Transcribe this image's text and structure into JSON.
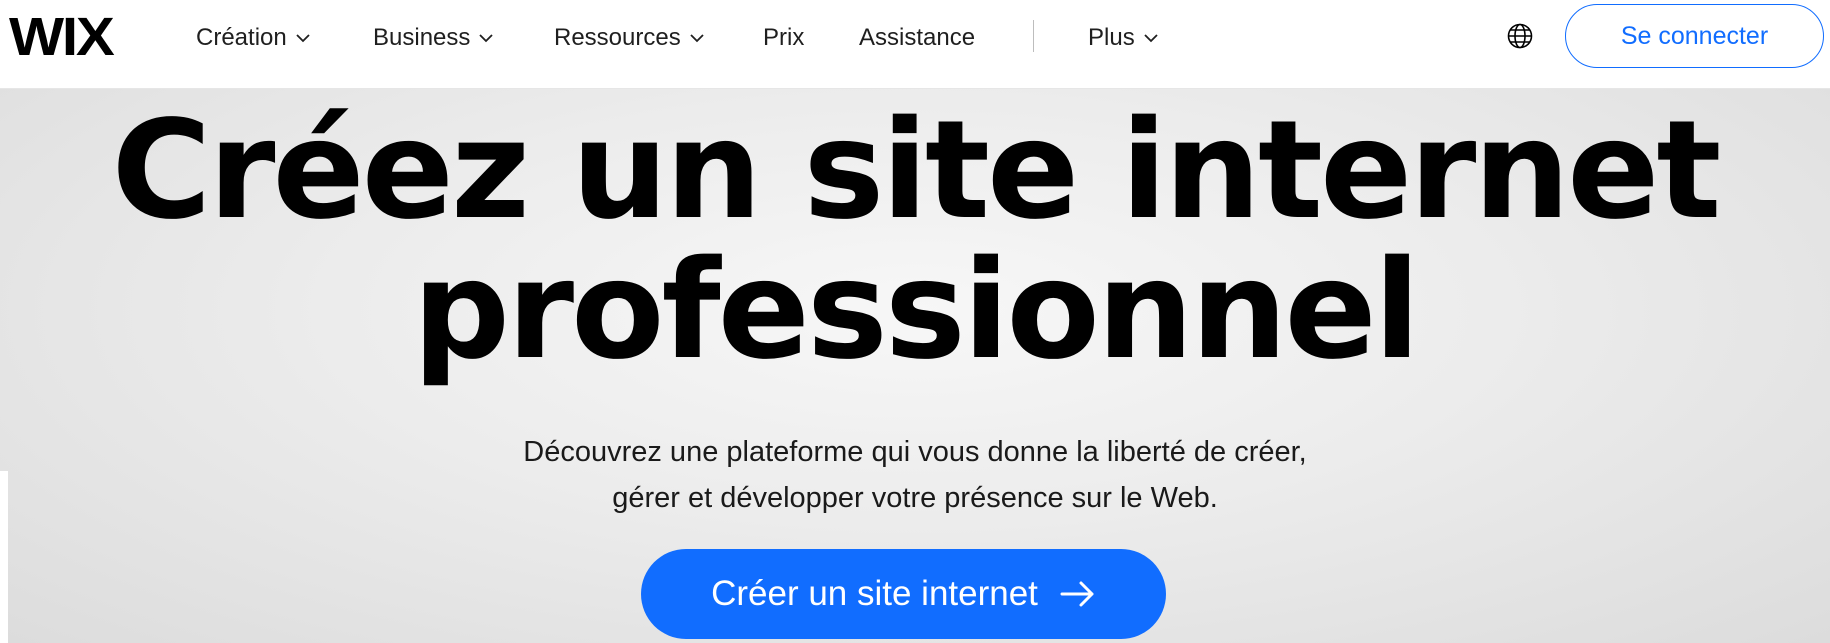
{
  "header": {
    "logo": "WIX",
    "nav": [
      {
        "label": "Création",
        "has_dropdown": true
      },
      {
        "label": "Business",
        "has_dropdown": true
      },
      {
        "label": "Ressources",
        "has_dropdown": true
      },
      {
        "label": "Prix",
        "has_dropdown": false
      },
      {
        "label": "Assistance",
        "has_dropdown": false
      },
      {
        "label": "Plus",
        "has_dropdown": true
      }
    ],
    "language_icon": "globe-icon",
    "login_label": "Se connecter"
  },
  "hero": {
    "headline_line1": "Créez un site internet",
    "headline_line2": "professionnel",
    "subtitle_line1": "Découvrez une plateforme qui vous donne la liberté de créer,",
    "subtitle_line2": "gérer et développer votre présence sur le Web.",
    "cta_label": "Créer un site internet",
    "cta_icon": "arrow-right-icon"
  },
  "colors": {
    "accent": "#116dff",
    "header_bg": "#ffffff",
    "hero_bg": "#ebebeb",
    "text": "#000000"
  }
}
